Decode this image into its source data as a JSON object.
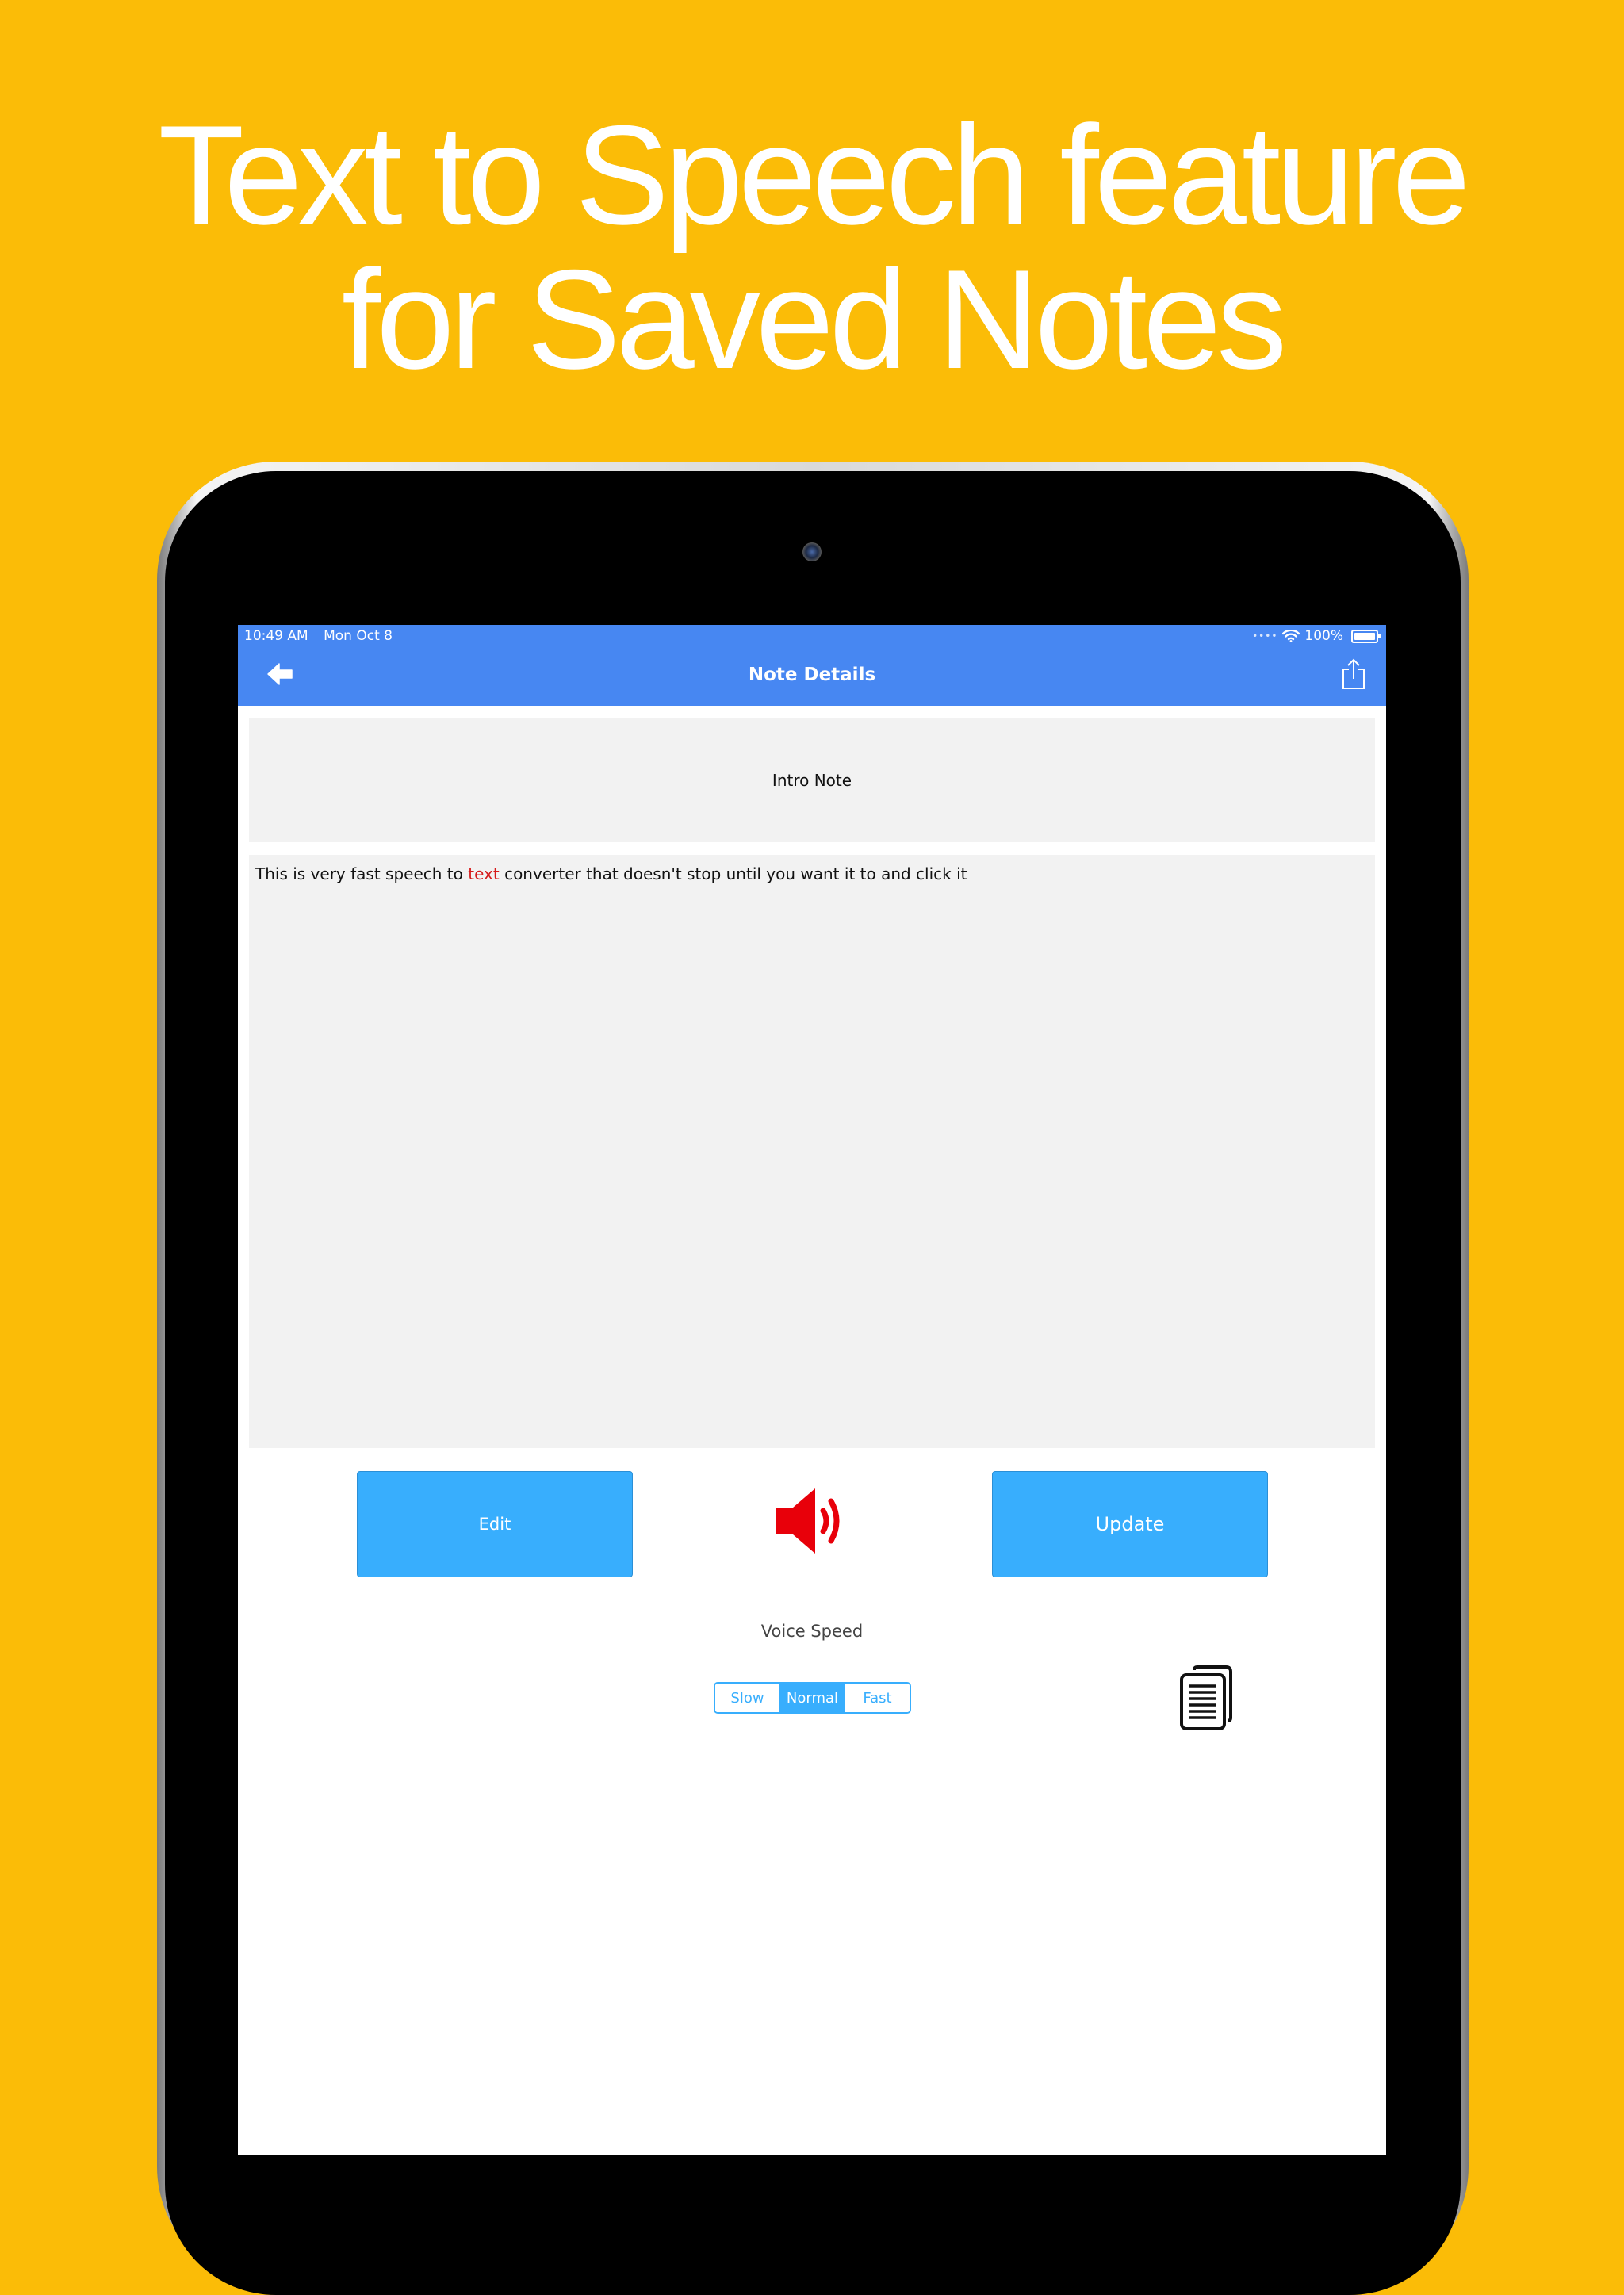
{
  "headline": {
    "line1": "Text to Speech feature",
    "line2": "for Saved Notes"
  },
  "status_bar": {
    "time": "10:49 AM",
    "date": "Mon Oct 8",
    "battery": "100%"
  },
  "nav": {
    "title": "Note Details",
    "back_icon": "back-arrow-icon",
    "share_icon": "share-icon"
  },
  "note": {
    "title": "Intro Note",
    "body_before": "This is very fast speech to ",
    "body_highlight": "text",
    "body_after": " converter that doesn't stop until you want it to and click it"
  },
  "actions": {
    "edit_label": "Edit",
    "update_label": "Update",
    "speaker_icon": "speaker-icon",
    "copy_icon": "copy-document-icon"
  },
  "voice_speed": {
    "label": "Voice Speed",
    "options": [
      "Slow",
      "Normal",
      "Fast"
    ],
    "selected": "Normal"
  },
  "colors": {
    "background": "#FBBC07",
    "nav_bar": "#4787F2",
    "button": "#38AEFD",
    "highlight_text": "#D61A1A",
    "speaker": "#E8000A"
  }
}
